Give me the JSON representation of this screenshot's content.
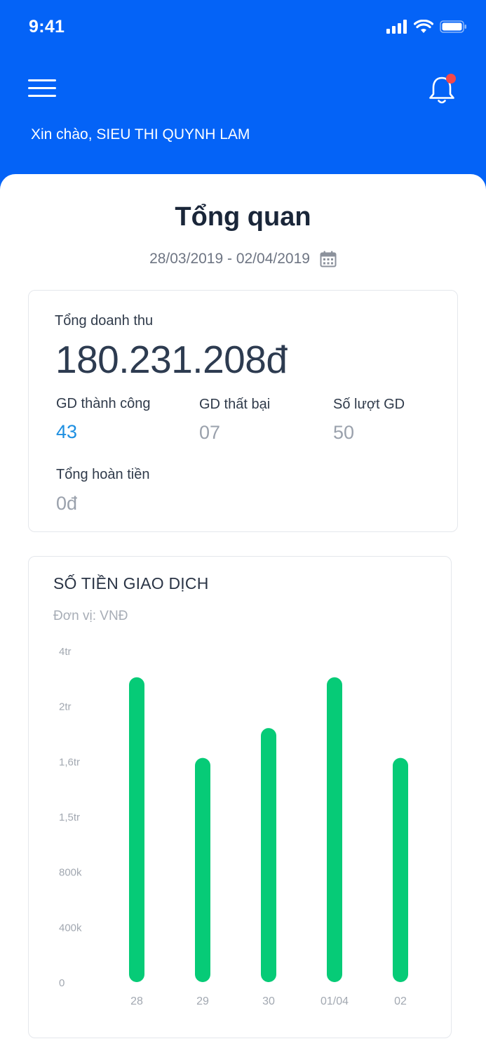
{
  "status_bar": {
    "time": "9:41"
  },
  "header": {
    "greeting": "Xin chào, SIEU THI QUYNH LAM"
  },
  "overview": {
    "title": "Tổng quan",
    "date_range": "28/03/2019 - 02/04/2019"
  },
  "summary": {
    "total_revenue_label": "Tổng doanh thu",
    "total_revenue_value": "180.231.208đ",
    "success_label": "GD thành công",
    "success_value": "43",
    "failed_label": "GD thất bại",
    "failed_value": "07",
    "count_label": "Số lượt GD",
    "count_value": "50",
    "refund_label": "Tổng hoàn tiền",
    "refund_value": "0đ"
  },
  "colors": {
    "brand_blue": "#0463F7",
    "success_blue": "#1D8FE1",
    "bar_green": "#06CB77",
    "notification_red": "#F5484A"
  },
  "chart_data": {
    "type": "bar",
    "title": "SỐ TIỀN GIAO DỊCH",
    "unit_label": "Đơn vị: VNĐ",
    "categories": [
      "28",
      "29",
      "30",
      "01/04",
      "02"
    ],
    "y_ticks": [
      "4tr",
      "2tr",
      "1,6tr",
      "1,5tr",
      "800k",
      "400k",
      "0"
    ],
    "y_tick_index_values": [
      6,
      5,
      4,
      3,
      2,
      1,
      0
    ],
    "values_in_tick_index": [
      5.52,
      4.06,
      4.6,
      5.52,
      4.06
    ],
    "ylim_tick_index": [
      0,
      6
    ],
    "grid": false,
    "legend": "none"
  }
}
